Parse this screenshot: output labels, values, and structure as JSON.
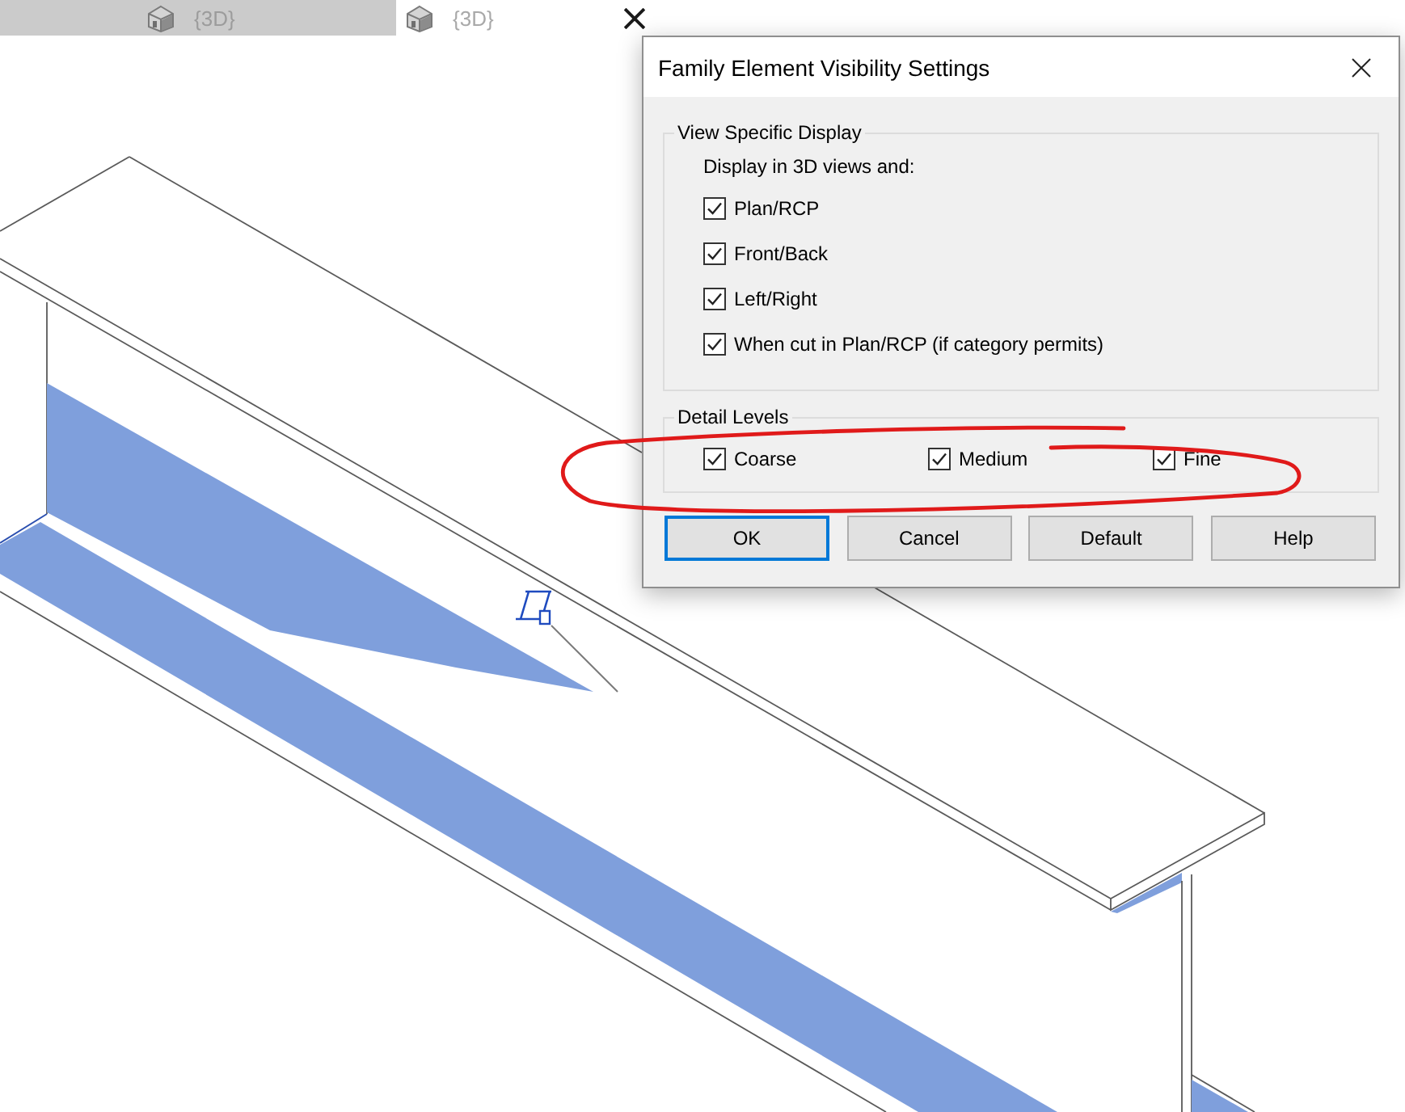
{
  "tabs": [
    {
      "label": "{3D}",
      "selected": false
    },
    {
      "label": "{3D}",
      "selected": true
    }
  ],
  "dialog": {
    "title": "Family Element Visibility Settings",
    "groups": [
      {
        "kind": "column",
        "title": "View Specific Display",
        "caption": "Display in 3D views and:",
        "options": [
          {
            "label": "Plan/RCP",
            "checked": true
          },
          {
            "label": "Front/Back",
            "checked": true
          },
          {
            "label": "Left/Right",
            "checked": true
          },
          {
            "label": "When cut in Plan/RCP (if category permits)",
            "checked": true
          }
        ]
      },
      {
        "kind": "row",
        "title": "Detail Levels",
        "options": [
          {
            "label": "Coarse",
            "checked": true
          },
          {
            "label": "Medium",
            "checked": true
          },
          {
            "label": "Fine",
            "checked": true
          }
        ]
      }
    ],
    "buttons": [
      {
        "label": "OK",
        "default": true
      },
      {
        "label": "Cancel",
        "default": false
      },
      {
        "label": "Default",
        "default": false
      },
      {
        "label": "Help",
        "default": false
      }
    ]
  }
}
